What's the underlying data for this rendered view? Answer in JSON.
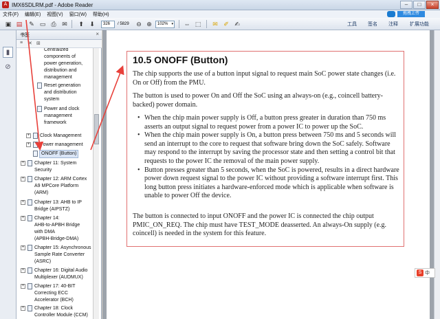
{
  "window": {
    "title": "IMX6SDLRM.pdf - Adobe Reader",
    "app_icon": "adobe-reader-icon"
  },
  "menu": {
    "items": [
      "文件(F)",
      "编辑(E)",
      "视图(V)",
      "窗口(W)",
      "帮助(H)"
    ],
    "help_tip": "拖拽上传"
  },
  "toolbar": {
    "page_current": "326",
    "page_total": "/ 5829",
    "zoom": "102%",
    "right_items": [
      "工具",
      "签名",
      "注释",
      "扩展功能"
    ]
  },
  "bookmarks": {
    "header": "书签",
    "items": [
      {
        "text": "Centralized\ncomponents of\npower generation,\ndistribution and\nmanagement",
        "level": 3
      },
      {
        "text": "Reset generation\nand distribution\nsystem",
        "level": 3
      },
      {
        "text": "Power and clock\nmanagement\nframework",
        "level": 3
      },
      {
        "text": "Clock Management",
        "level": 2
      },
      {
        "text": "Power management",
        "level": 2
      },
      {
        "text": "ONOFF (Button)",
        "level": 2,
        "selected": true
      },
      {
        "text": "Chapter 11: System\nSecurity",
        "level": 1
      },
      {
        "text": "Chapter 12: ARM Cortex\nA9 MPCore Platform\n(ARM)",
        "level": 1
      },
      {
        "text": "Chapter 13: AHB to IP\nBridge (AIPSTZ)",
        "level": 1
      },
      {
        "text": "Chapter 14:\nAHB-to-APBH Bridge\nwith DMA\n(APBH-Bridge-DMA)",
        "level": 1
      },
      {
        "text": "Chapter 15: Asynchronous\nSample Rate Converter\n(ASRC)",
        "level": 1
      },
      {
        "text": "Chapter 16: Digital Audio\nMultiplexer (AUDMUX)",
        "level": 1
      },
      {
        "text": "Chapter 17: 40-BIT\nCorrecting ECC\nAccelerator (BCH)",
        "level": 1
      },
      {
        "text": "Chapter 18: Clock\nController Module (CCM)",
        "level": 1
      }
    ]
  },
  "document": {
    "heading": "10.5   ONOFF (Button)",
    "para1": "The chip supports the use of a button input signal to request main SoC power state changes (i.e. On or Off) from the PMU.",
    "para2": "The button is used to power On and Off the SoC using an always-on (e.g., coincell battery-backed) power domain.",
    "bullets": [
      "When the chip main power supply is Off, a button press greater in duration than 750 ms asserts an output signal to request power from a power IC to power up the SoC.",
      "When the chip main power supply is On, a button press between 750 ms and 5 seconds will send an interrupt to the core to request that software bring down the SoC safely. Software may respond to the interrupt by saving the processor state and then setting a control bit that requests to the power IC the removal of the main power supply.",
      "Button presses greater than 5 seconds, when the SoC is powered, results in a direct hardware power down request signal to the power IC without providing a software interrupt first. This long button press initiates a hardware-enforced mode which is applicable when software is unable to power Off the device."
    ],
    "para3": "The button is connected to input ONOFF and the power IC is connected the chip output PMIC_ON_REQ. The chip must have TEST_MODE deasserted. An always-On supply (e.g. coincell) is needed in the system for this feature."
  },
  "ime": {
    "label": "中"
  },
  "annotation_color": "#e8403a"
}
